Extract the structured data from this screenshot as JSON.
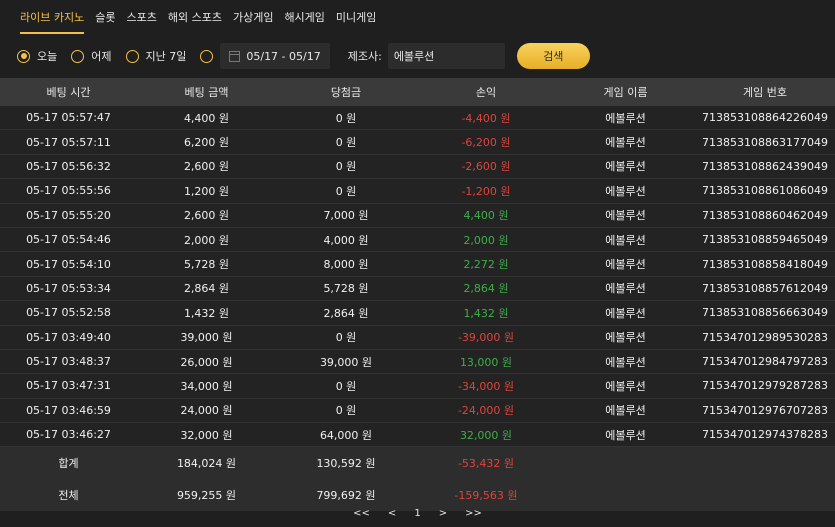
{
  "tabs": [
    "라이브 카지노",
    "슬롯",
    "스포츠",
    "해외 스포츠",
    "가상게임",
    "해시게임",
    "미니게임"
  ],
  "filters": {
    "today": "오늘",
    "yesterday": "어제",
    "last7": "지난 7일",
    "date_range": "05/17 - 05/17",
    "vendor_label": "제조사:",
    "vendor_value": "에볼루션",
    "search_button": "검색"
  },
  "table": {
    "headers": [
      "베팅 시간",
      "베팅 금액",
      "당첨금",
      "손익",
      "게임 이름",
      "게임 번호"
    ],
    "rows": [
      {
        "time": "05-17 05:57:47",
        "bet": "4,400 원",
        "win": "0 원",
        "pl": "-4,400 원",
        "pl_sign": "neg",
        "game": "에볼루션",
        "no": "713853108864226049"
      },
      {
        "time": "05-17 05:57:11",
        "bet": "6,200 원",
        "win": "0 원",
        "pl": "-6,200 원",
        "pl_sign": "neg",
        "game": "에볼루션",
        "no": "713853108863177049"
      },
      {
        "time": "05-17 05:56:32",
        "bet": "2,600 원",
        "win": "0 원",
        "pl": "-2,600 원",
        "pl_sign": "neg",
        "game": "에볼루션",
        "no": "713853108862439049"
      },
      {
        "time": "05-17 05:55:56",
        "bet": "1,200 원",
        "win": "0 원",
        "pl": "-1,200 원",
        "pl_sign": "neg",
        "game": "에볼루션",
        "no": "713853108861086049"
      },
      {
        "time": "05-17 05:55:20",
        "bet": "2,600 원",
        "win": "7,000 원",
        "pl": "4,400 원",
        "pl_sign": "pos",
        "game": "에볼루션",
        "no": "713853108860462049"
      },
      {
        "time": "05-17 05:54:46",
        "bet": "2,000 원",
        "win": "4,000 원",
        "pl": "2,000 원",
        "pl_sign": "pos",
        "game": "에볼루션",
        "no": "713853108859465049"
      },
      {
        "time": "05-17 05:54:10",
        "bet": "5,728 원",
        "win": "8,000 원",
        "pl": "2,272 원",
        "pl_sign": "pos",
        "game": "에볼루션",
        "no": "713853108858418049"
      },
      {
        "time": "05-17 05:53:34",
        "bet": "2,864 원",
        "win": "5,728 원",
        "pl": "2,864 원",
        "pl_sign": "pos",
        "game": "에볼루션",
        "no": "713853108857612049"
      },
      {
        "time": "05-17 05:52:58",
        "bet": "1,432 원",
        "win": "2,864 원",
        "pl": "1,432 원",
        "pl_sign": "pos",
        "game": "에볼루션",
        "no": "713853108856663049"
      },
      {
        "time": "05-17 03:49:40",
        "bet": "39,000 원",
        "win": "0 원",
        "pl": "-39,000 원",
        "pl_sign": "neg",
        "game": "에볼루션",
        "no": "715347012989530283"
      },
      {
        "time": "05-17 03:48:37",
        "bet": "26,000 원",
        "win": "39,000 원",
        "pl": "13,000 원",
        "pl_sign": "pos",
        "game": "에볼루션",
        "no": "715347012984797283"
      },
      {
        "time": "05-17 03:47:31",
        "bet": "34,000 원",
        "win": "0 원",
        "pl": "-34,000 원",
        "pl_sign": "neg",
        "game": "에볼루션",
        "no": "715347012979287283"
      },
      {
        "time": "05-17 03:46:59",
        "bet": "24,000 원",
        "win": "0 원",
        "pl": "-24,000 원",
        "pl_sign": "neg",
        "game": "에볼루션",
        "no": "715347012976707283"
      },
      {
        "time": "05-17 03:46:27",
        "bet": "32,000 원",
        "win": "64,000 원",
        "pl": "32,000 원",
        "pl_sign": "pos",
        "game": "에볼루션",
        "no": "715347012974378283"
      }
    ],
    "subtotal": {
      "label": "합계",
      "bet": "184,024 원",
      "win": "130,592 원",
      "pl": "-53,432 원"
    },
    "total": {
      "label": "전체",
      "bet": "959,255 원",
      "win": "799,692 원",
      "pl": "-159,563 원"
    }
  },
  "pagination": {
    "first": "<<",
    "prev": "<",
    "page": "1",
    "next": ">",
    "last": ">>"
  },
  "colors": {
    "accent": "#f2c04a",
    "negative": "#e0443a",
    "positive": "#3fae49"
  }
}
